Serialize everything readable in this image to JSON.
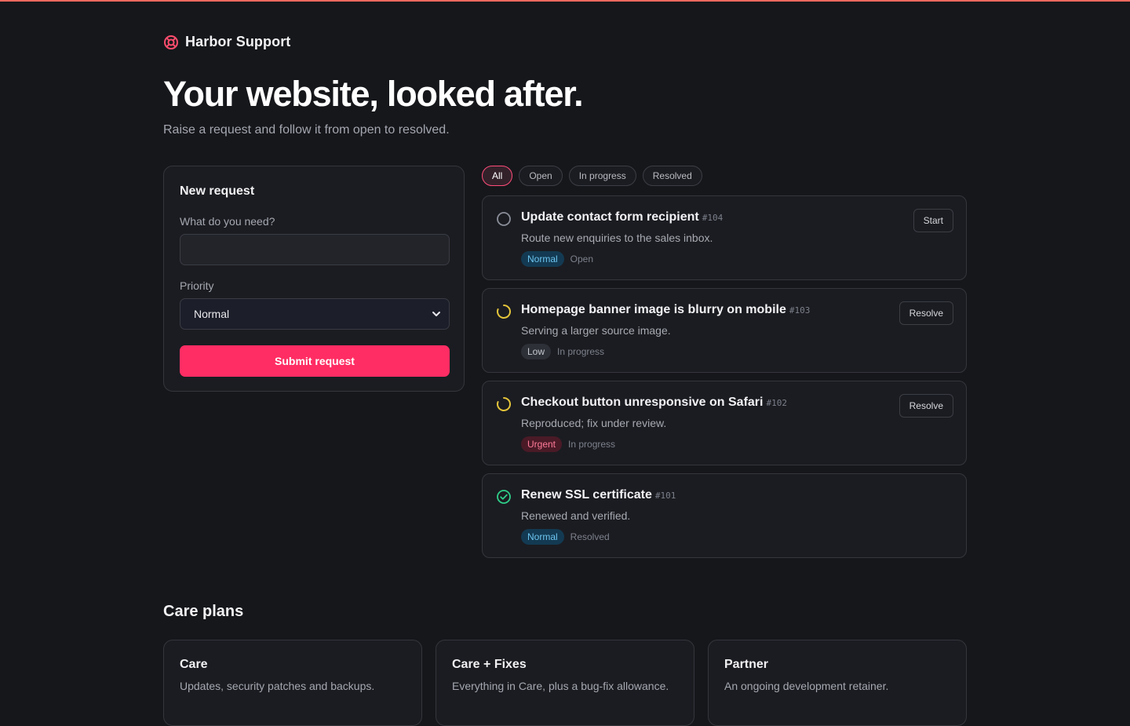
{
  "colors": {
    "accent": "#ff2d63",
    "background": "#16171b",
    "card": "#1b1c21",
    "in_progress": "#e5c53a",
    "resolved": "#2fcf8a"
  },
  "brand": {
    "name": "Harbor Support",
    "icon": "lifebuoy-icon"
  },
  "hero": {
    "title": "Your website, looked after.",
    "subtitle": "Raise a request and follow it from open to resolved."
  },
  "form": {
    "title": "New request",
    "need_label": "What do you need?",
    "need_value": "",
    "priority_label": "Priority",
    "priority_value": "Normal",
    "submit_label": "Submit request"
  },
  "filters": [
    {
      "label": "All",
      "active": true
    },
    {
      "label": "Open",
      "active": false
    },
    {
      "label": "In progress",
      "active": false
    },
    {
      "label": "Resolved",
      "active": false
    }
  ],
  "tickets": [
    {
      "title": "Update contact form recipient",
      "id": "#104",
      "description": "Route new enquiries to the sales inbox.",
      "priority": "Normal",
      "status": "Open",
      "status_icon": "circle-outline-icon",
      "action": "Start"
    },
    {
      "title": "Homepage banner image is blurry on mobile",
      "id": "#103",
      "description": "Serving a larger source image.",
      "priority": "Low",
      "status": "In progress",
      "status_icon": "spinner-icon",
      "action": "Resolve"
    },
    {
      "title": "Checkout button unresponsive on Safari",
      "id": "#102",
      "description": "Reproduced; fix under review.",
      "priority": "Urgent",
      "status": "In progress",
      "status_icon": "spinner-icon",
      "action": "Resolve"
    },
    {
      "title": "Renew SSL certificate",
      "id": "#101",
      "description": "Renewed and verified.",
      "priority": "Normal",
      "status": "Resolved",
      "status_icon": "check-circle-icon",
      "action": ""
    }
  ],
  "plans": {
    "title": "Care plans",
    "items": [
      {
        "name": "Care",
        "description": "Updates, security patches and backups."
      },
      {
        "name": "Care + Fixes",
        "description": "Everything in Care, plus a bug-fix allowance."
      },
      {
        "name": "Partner",
        "description": "An ongoing development retainer."
      }
    ]
  }
}
